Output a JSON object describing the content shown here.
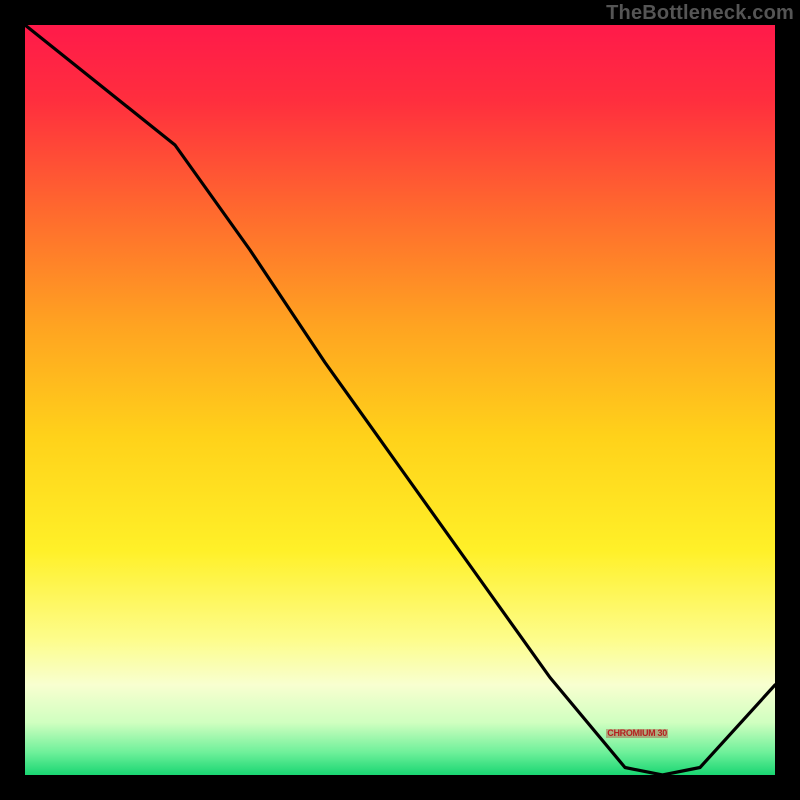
{
  "attribution": "TheBottleneck.com",
  "red_label": {
    "text": "CHROMIUM 30",
    "x_pct": 81.5,
    "y_pct": 93.8
  },
  "chart_data": {
    "type": "line",
    "title": "",
    "xlabel": "",
    "ylabel": "",
    "xlim": [
      0,
      100
    ],
    "ylim": [
      0,
      100
    ],
    "grid": false,
    "series": [
      {
        "name": "curve",
        "x": [
          0,
          10,
          20,
          30,
          40,
          50,
          60,
          70,
          80,
          85,
          90,
          100
        ],
        "y": [
          100,
          92,
          84,
          70,
          55,
          41,
          27,
          13,
          1,
          0,
          1,
          12
        ]
      }
    ],
    "background_gradient_description": "vertical rainbow red→orange→yellow→pale→green",
    "gradient_stops": [
      {
        "offset": 0.0,
        "color": "#ff1a4a"
      },
      {
        "offset": 0.1,
        "color": "#ff2e3e"
      },
      {
        "offset": 0.25,
        "color": "#ff6a2e"
      },
      {
        "offset": 0.4,
        "color": "#ffa321"
      },
      {
        "offset": 0.55,
        "color": "#ffd21a"
      },
      {
        "offset": 0.7,
        "color": "#fff028"
      },
      {
        "offset": 0.82,
        "color": "#fdfd8c"
      },
      {
        "offset": 0.88,
        "color": "#f8ffd0"
      },
      {
        "offset": 0.93,
        "color": "#d0ffc0"
      },
      {
        "offset": 0.97,
        "color": "#6ef09a"
      },
      {
        "offset": 1.0,
        "color": "#19d672"
      }
    ]
  }
}
